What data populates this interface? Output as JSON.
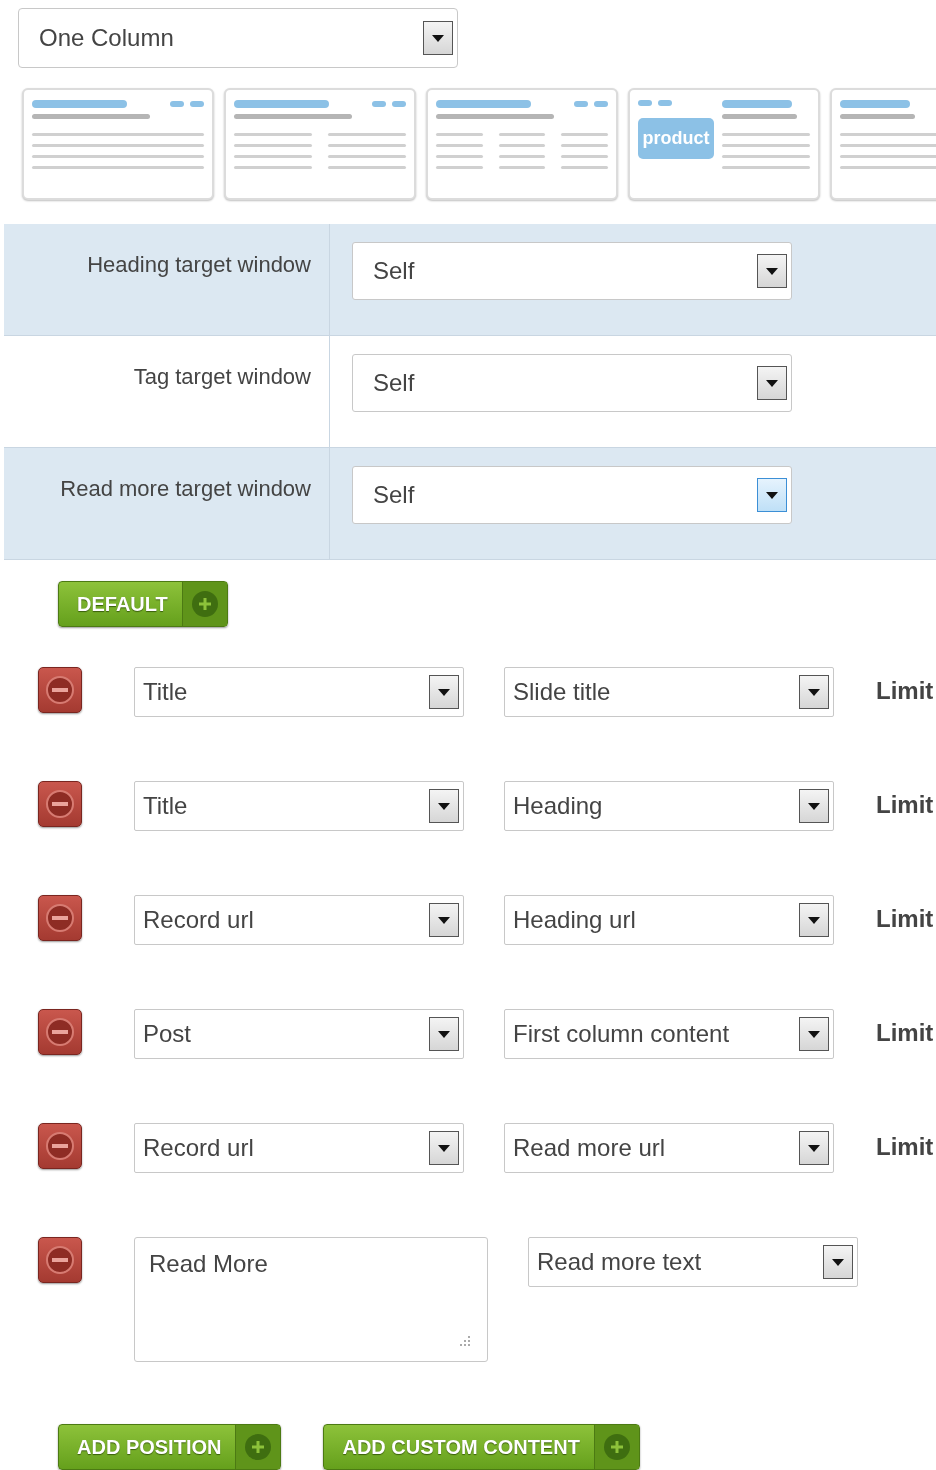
{
  "layout_select": {
    "value": "One Column"
  },
  "layout_thumbnails": [
    {
      "kind": "one",
      "selected": false
    },
    {
      "kind": "two",
      "selected": false
    },
    {
      "kind": "three",
      "selected": false
    },
    {
      "kind": "product-left",
      "badge": "product",
      "selected": false
    },
    {
      "kind": "product-right",
      "selected": false
    }
  ],
  "settings": [
    {
      "label": "Heading target window",
      "value": "Self",
      "shaded": true,
      "focused": false
    },
    {
      "label": "Tag target window",
      "value": "Self",
      "shaded": false,
      "focused": false
    },
    {
      "label": "Read more target window",
      "value": "Self",
      "shaded": true,
      "focused": true
    }
  ],
  "default_button": "DEFAULT",
  "mappings": [
    {
      "kind": "select",
      "source": "Title",
      "target": "Slide title",
      "limit": "Limit"
    },
    {
      "kind": "select",
      "source": "Title",
      "target": "Heading",
      "limit": "Limit"
    },
    {
      "kind": "select",
      "source": "Record url",
      "target": "Heading url",
      "limit": "Limit"
    },
    {
      "kind": "select",
      "source": "Post",
      "target": "First column content",
      "limit": "Limit"
    },
    {
      "kind": "select",
      "source": "Record url",
      "target": "Read more url",
      "limit": "Limit"
    },
    {
      "kind": "text",
      "source": "Read More",
      "target": "Read more text"
    }
  ],
  "bottom_buttons": [
    "ADD POSITION",
    "ADD CUSTOM CONTENT"
  ]
}
